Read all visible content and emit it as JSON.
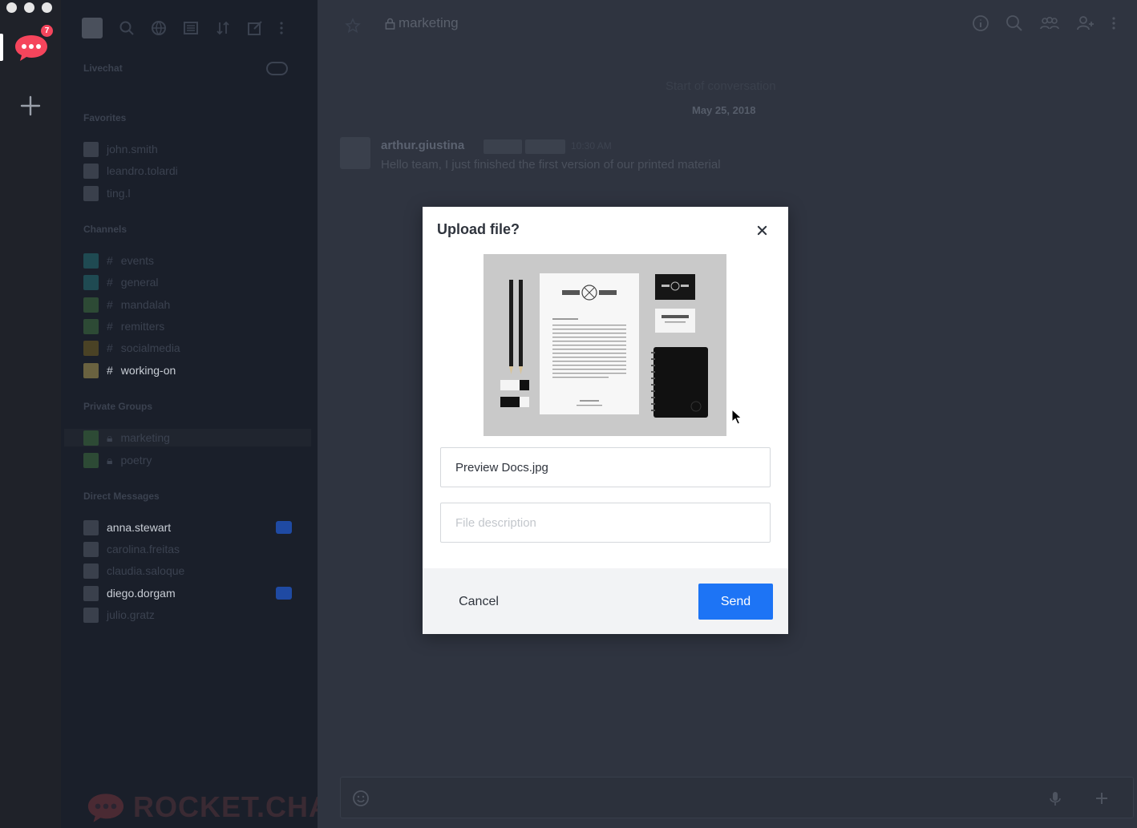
{
  "rail": {
    "notification_count": "7"
  },
  "sidebar": {
    "sections": {
      "livechat": "Livechat",
      "favorites": "Favorites",
      "channels": "Channels",
      "private_groups": "Private Groups",
      "direct_messages": "Direct Messages"
    },
    "favorites": [
      "john.smith",
      "leandro.tolardi",
      "ting.l"
    ],
    "channels": [
      "events",
      "general",
      "mandalah",
      "remitters",
      "socialmedia",
      "working-on"
    ],
    "private_groups": [
      "marketing",
      "poetry"
    ],
    "direct_messages": [
      "anna.stewart",
      "carolina.freitas",
      "claudia.saloque",
      "diego.dorgam",
      "julio.gratz"
    ],
    "brand": "ROCKET.CHAT"
  },
  "main": {
    "room_title": "marketing",
    "start_conversation": "Start of conversation",
    "date": "May 25, 2018",
    "message": {
      "user": "arthur.giustina",
      "time": "10:30 AM",
      "text": "Hello team, I just finished the first version of our printed material"
    }
  },
  "modal": {
    "title": "Upload file?",
    "file_name_value": "Preview Docs.jpg",
    "description_placeholder": "File description",
    "cancel_label": "Cancel",
    "send_label": "Send"
  },
  "colors": {
    "accent": "#1d74f5",
    "badge": "#f5455c"
  }
}
